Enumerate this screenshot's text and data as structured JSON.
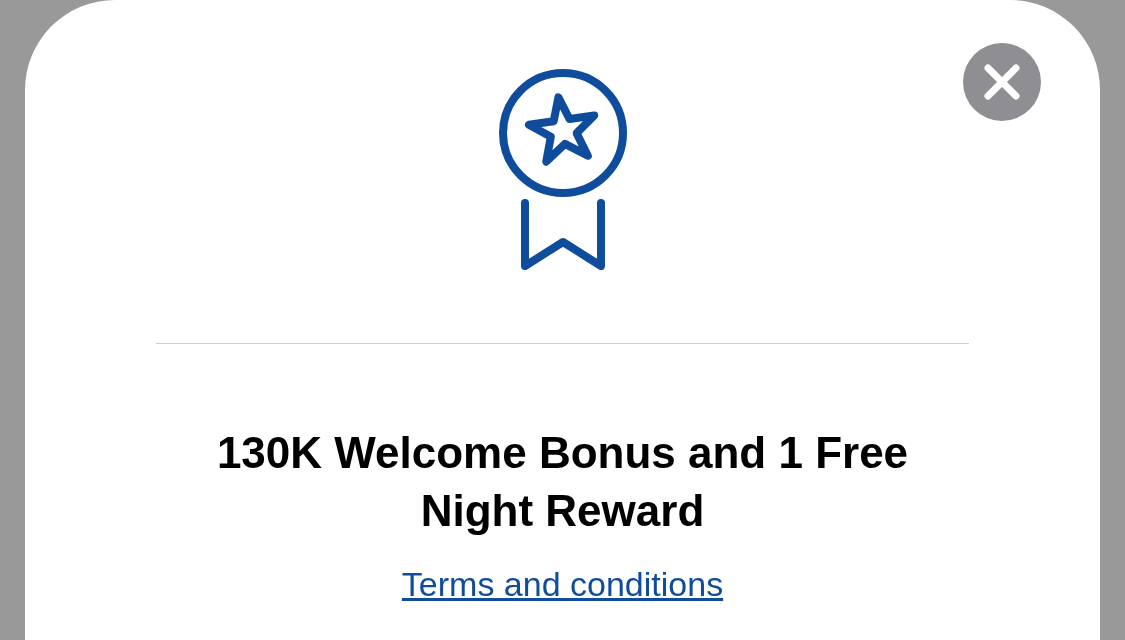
{
  "sheet": {
    "title": "130K Welcome Bonus and 1 Free Night Reward",
    "link": "Terms and conditions"
  }
}
